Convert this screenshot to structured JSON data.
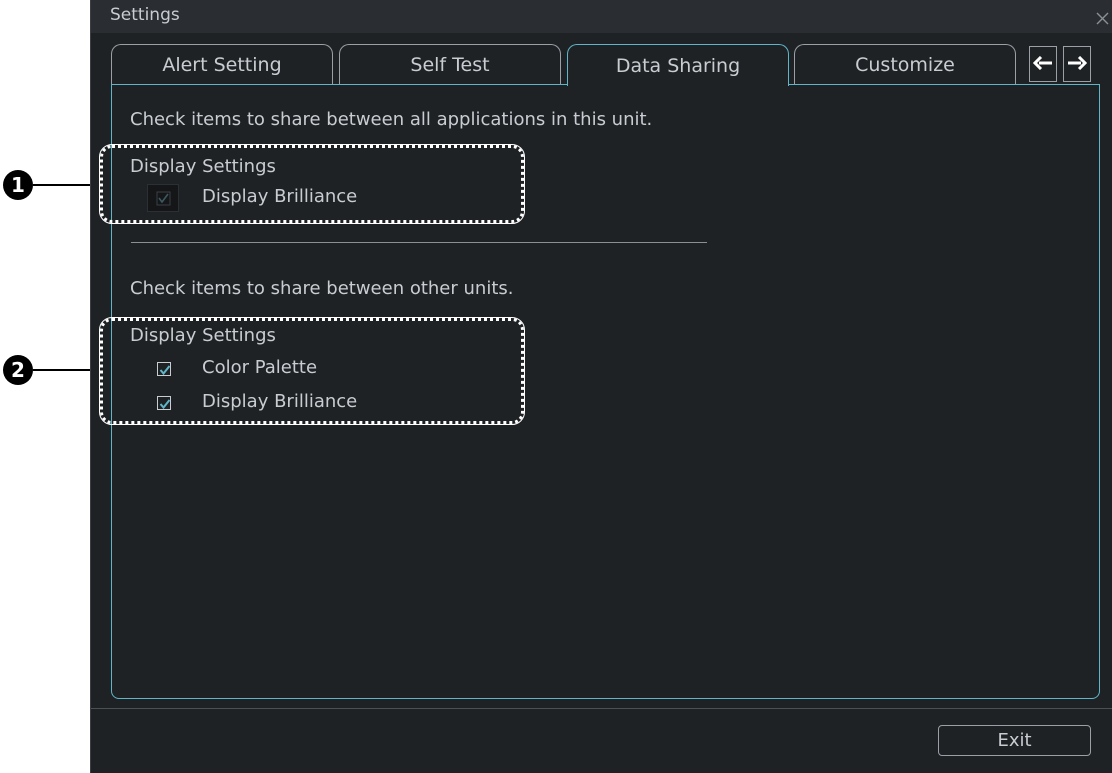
{
  "window": {
    "title": "Settings"
  },
  "tabs": [
    {
      "label": "Alert Setting"
    },
    {
      "label": "Self Test"
    },
    {
      "label": "Data Sharing",
      "active": true
    },
    {
      "label": "Customize"
    }
  ],
  "section1": {
    "instruction": "Check items to share between all applications in this unit.",
    "group_label": "Display Settings",
    "items": [
      {
        "label": "Display Brilliance",
        "checked": true,
        "disabled": true
      }
    ]
  },
  "section2": {
    "instruction": "Check items to share between other units.",
    "group_label": "Display Settings",
    "items": [
      {
        "label": "Color Palette",
        "checked": true
      },
      {
        "label": "Display Brilliance",
        "checked": true
      }
    ]
  },
  "footer": {
    "exit_label": "Exit"
  },
  "callouts": [
    {
      "number": "1"
    },
    {
      "number": "2"
    }
  ],
  "colors": {
    "accent": "#5fb6c8",
    "background": "#1f2225",
    "text": "#c8cdd2"
  },
  "icons": {
    "close": "close-icon",
    "left": "arrow-left-icon",
    "right": "arrow-right-icon",
    "check": "checkmark-icon"
  }
}
